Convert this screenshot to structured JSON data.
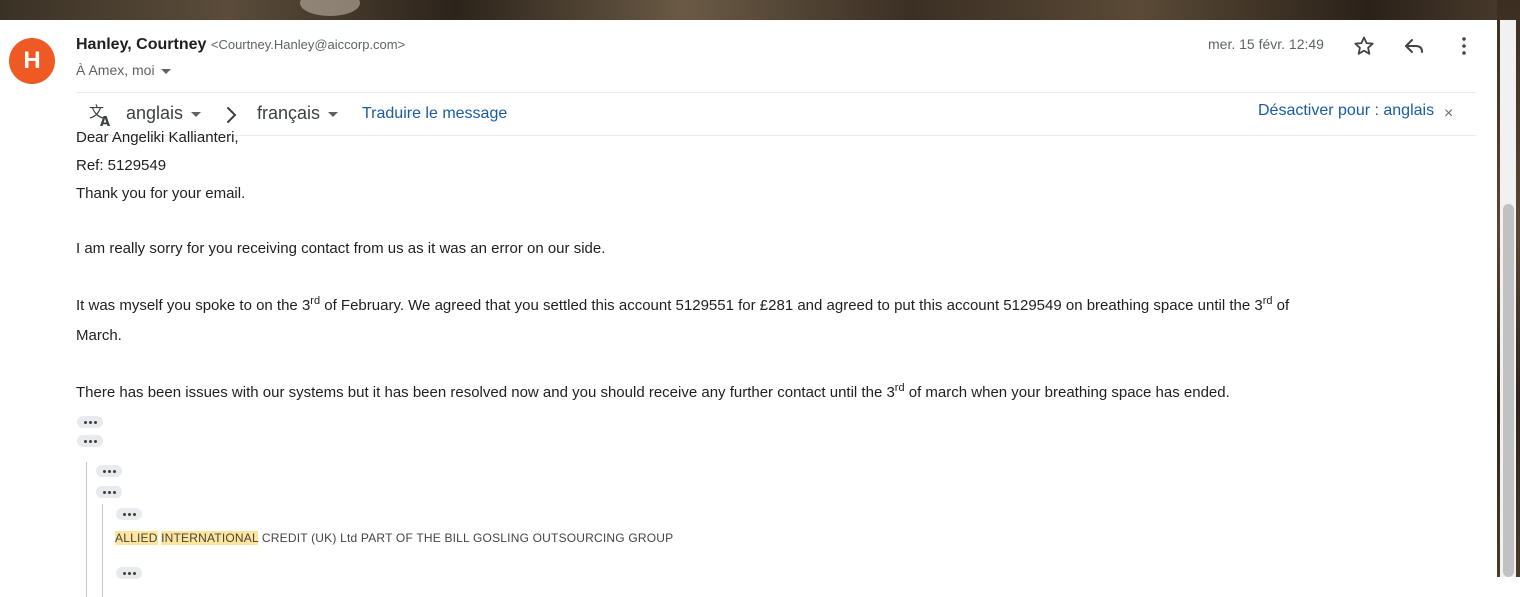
{
  "email": {
    "avatar_letter": "H",
    "sender_name": "Hanley, Courtney",
    "sender_email": "<Courtney.Hanley@aiccorp.com>",
    "recipients": "À Amex, moi",
    "date": "mer. 15 févr. 12:49"
  },
  "translate": {
    "from_lang": "anglais",
    "to_lang": "français",
    "translate_link": "Traduire le message",
    "disable_link": "Désactiver pour : anglais",
    "close": "×"
  },
  "body": {
    "greeting": "Dear Angeliki Kallianteri,",
    "ref": "Ref: 5129549",
    "thanks": "Thank you for your email.",
    "p1": "I am really sorry for you receiving contact from us as it was an error on our side.",
    "p2_a": "It was myself you spoke to on the 3",
    "p2_sup1": "rd",
    "p2_b": " of February.  We agreed that you settled this account 5129551 for £281 and agreed to put this account 5129549 on breathing space until the 3",
    "p2_sup2": "rd",
    "p2_c": " of",
    "p2_d": "March.",
    "p3_a": "There has been issues with our systems but it has been resolved now and you should receive any further contact until the 3",
    "p3_sup": "rd",
    "p3_b": " of march when your breathing space has ended."
  },
  "footer": {
    "hl1": "ALLIED",
    "space": " ",
    "hl2": "INTERNATIONAL",
    "rest": " CREDIT (UK) Ltd PART OF THE BILL GOSLING OUTSOURCING GROUP"
  },
  "icons": {
    "star": "star-icon",
    "reply": "reply-icon",
    "more": "more-vert-icon",
    "translate": "translate-icon"
  },
  "colors": {
    "avatar": "#ef5a24",
    "link": "#1a5aa6",
    "highlight": "#fde59b"
  }
}
